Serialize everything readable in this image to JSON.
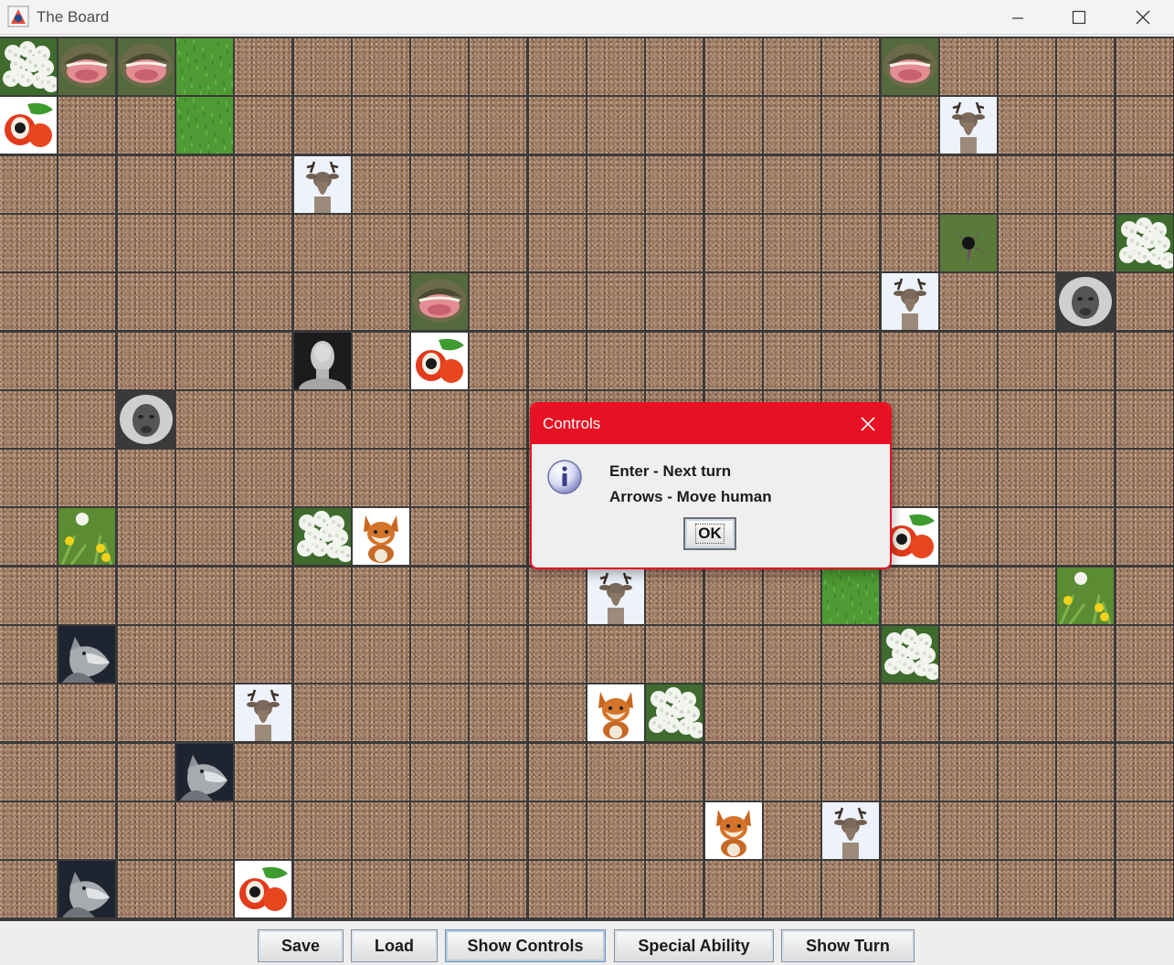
{
  "window": {
    "title": "The Board"
  },
  "board": {
    "cols": 20,
    "rows": 15,
    "organisms": [
      {
        "row": 0,
        "col": 0,
        "kind": "hogweed"
      },
      {
        "row": 0,
        "col": 1,
        "kind": "turtle"
      },
      {
        "row": 0,
        "col": 2,
        "kind": "turtle"
      },
      {
        "row": 0,
        "col": 3,
        "kind": "grass"
      },
      {
        "row": 0,
        "col": 15,
        "kind": "turtle"
      },
      {
        "row": 1,
        "col": 0,
        "kind": "guarana"
      },
      {
        "row": 1,
        "col": 3,
        "kind": "grass"
      },
      {
        "row": 1,
        "col": 16,
        "kind": "antelope"
      },
      {
        "row": 2,
        "col": 5,
        "kind": "antelope"
      },
      {
        "row": 3,
        "col": 16,
        "kind": "belladonna"
      },
      {
        "row": 3,
        "col": 19,
        "kind": "hogweed"
      },
      {
        "row": 4,
        "col": 7,
        "kind": "turtle"
      },
      {
        "row": 4,
        "col": 15,
        "kind": "antelope"
      },
      {
        "row": 4,
        "col": 18,
        "kind": "sheep"
      },
      {
        "row": 5,
        "col": 5,
        "kind": "human"
      },
      {
        "row": 5,
        "col": 7,
        "kind": "guarana"
      },
      {
        "row": 6,
        "col": 2,
        "kind": "sheep"
      },
      {
        "row": 8,
        "col": 1,
        "kind": "dandelion"
      },
      {
        "row": 8,
        "col": 5,
        "kind": "hogweed"
      },
      {
        "row": 8,
        "col": 6,
        "kind": "fox"
      },
      {
        "row": 8,
        "col": 15,
        "kind": "guarana"
      },
      {
        "row": 9,
        "col": 10,
        "kind": "antelope"
      },
      {
        "row": 9,
        "col": 14,
        "kind": "grass"
      },
      {
        "row": 9,
        "col": 18,
        "kind": "dandelion"
      },
      {
        "row": 10,
        "col": 1,
        "kind": "wolf"
      },
      {
        "row": 10,
        "col": 15,
        "kind": "hogweed"
      },
      {
        "row": 11,
        "col": 4,
        "kind": "antelope"
      },
      {
        "row": 11,
        "col": 10,
        "kind": "fox"
      },
      {
        "row": 11,
        "col": 11,
        "kind": "hogweed"
      },
      {
        "row": 12,
        "col": 3,
        "kind": "wolf"
      },
      {
        "row": 13,
        "col": 12,
        "kind": "fox"
      },
      {
        "row": 13,
        "col": 14,
        "kind": "antelope"
      },
      {
        "row": 14,
        "col": 1,
        "kind": "wolf"
      },
      {
        "row": 14,
        "col": 4,
        "kind": "guarana"
      }
    ]
  },
  "toolbar": {
    "save": "Save",
    "load": "Load",
    "show_controls": "Show Controls",
    "special_ability": "Special Ability",
    "show_turn": "Show Turn"
  },
  "dialog": {
    "title": "Controls",
    "line1": "Enter - Next turn",
    "line2": "Arrows - Move human",
    "ok": "OK",
    "icon": "info-icon"
  },
  "colors": {
    "dialog_accent": "#e81123",
    "sand": "#9d7a62",
    "grass": "#4f9a35"
  }
}
